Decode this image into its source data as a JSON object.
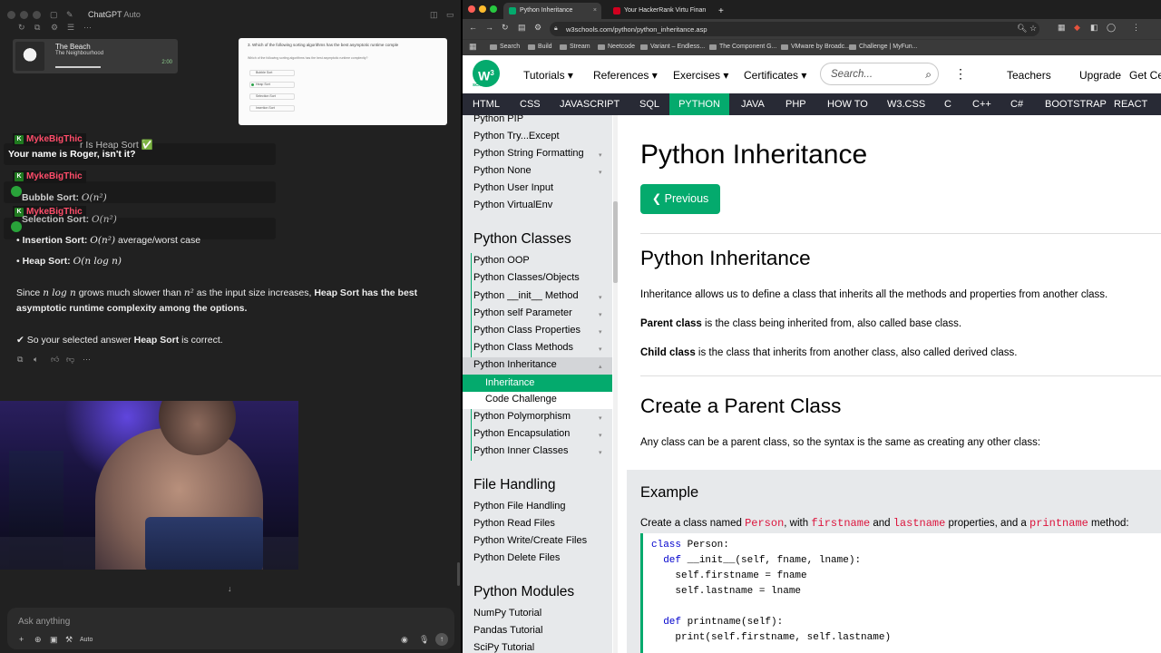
{
  "chat_window": {
    "app_title": "ChatGPT",
    "model_mode": "Auto",
    "music": {
      "song": "The Beach",
      "artist": "The Neighbourhood",
      "time": "2:00"
    },
    "quiz": {
      "question": "3. Which of the following sorting algorithms has the best asymptotic runtime comple",
      "prompt": "Which of the following sorting algorithms has the best asymptotic runtime complexity?",
      "options": [
        "Bubble Sort",
        "Heap Sort",
        "Selection Sort",
        "Insertion Sort"
      ]
    },
    "twitch": {
      "user": "MykeBigThic",
      "message": "Your name is Roger, isn't it?"
    },
    "partial_heading": "r Is Heap Sort ✅",
    "lines": {
      "bubble_label": "Bubble Sort:",
      "bubble_math": "O(n²)",
      "selection_label": "Selection Sort:",
      "selection_math": "O(n²)",
      "insertion_label": "Insertion Sort:",
      "insertion_math": "O(n²)",
      "insertion_suffix": "average/worst case",
      "heap_label": "Heap Sort:",
      "heap_math": "O(n log n)",
      "since_prefix": "Since",
      "since_math1": "n log n",
      "since_mid": "grows much slower than",
      "since_math2": "n²",
      "since_mid2": "as the input size increases,",
      "since_bold": "Heap Sort has the best",
      "since_line2": "asymptotic runtime complexity among the options.",
      "check_prefix": "✔ So your selected answer",
      "check_bold": "Heap Sort",
      "check_suffix": "is correct."
    },
    "composer": {
      "placeholder": "Ask anything",
      "mode": "Auto"
    }
  },
  "browser": {
    "tabs": [
      {
        "title": "Python Inheritance",
        "active": true
      },
      {
        "title": "Your HackerRank Virtu Finan",
        "active": false
      }
    ],
    "url": "w3schools.com/python/python_inheritance.asp",
    "bookmarks": [
      "Search",
      "Build",
      "Stream",
      "Neetcode",
      "Variant – Endless...",
      "The Component G...",
      "VMware by Broadc...",
      "Challenge | MyFun..."
    ]
  },
  "w3": {
    "logo_text": "W",
    "logo_sup": "3",
    "logo_sub": "schools",
    "nav": [
      "Tutorials ▾",
      "References ▾",
      "Exercises ▾",
      "Certificates ▾",
      "Teachers",
      "Upgrade",
      "Get Cer"
    ],
    "search_placeholder": "Search...",
    "topnav": [
      "HTML",
      "CSS",
      "JAVASCRIPT",
      "SQL",
      "PYTHON",
      "JAVA",
      "PHP",
      "HOW TO",
      "W3.CSS",
      "C",
      "C++",
      "C#",
      "BOOTSTRAP",
      "REACT"
    ],
    "sidebar": {
      "items_top": [
        "Python PIP",
        "Python Try...Except",
        "Python String Formatting",
        "Python None",
        "Python User Input",
        "Python VirtualEnv"
      ],
      "head_classes": "Python Classes",
      "items_classes": [
        "Python OOP",
        "Python Classes/Objects",
        "Python __init__ Method",
        "Python self Parameter",
        "Python Class Properties",
        "Python Class Methods",
        "Python Inheritance"
      ],
      "sub_active": "Inheritance",
      "sub_other": "Code Challenge",
      "items_after": [
        "Python Polymorphism",
        "Python Encapsulation",
        "Python Inner Classes"
      ],
      "head_files": "File Handling",
      "items_files": [
        "Python File Handling",
        "Python Read Files",
        "Python Write/Create Files",
        "Python Delete Files"
      ],
      "head_modules": "Python Modules",
      "items_modules": [
        "NumPy Tutorial",
        "Pandas Tutorial",
        "SciPy Tutorial"
      ]
    },
    "main": {
      "title": "Python Inheritance",
      "prev_button": "❮ Previous",
      "h2_inheritance": "Python Inheritance",
      "p1": "Inheritance allows us to define a class that inherits all the methods and properties from another class.",
      "p2_bold": "Parent class",
      "p2_rest": " is the class being inherited from, also called base class.",
      "p3_bold": "Child class",
      "p3_rest": " is the class that inherits from another class, also called derived class.",
      "h2_parent": "Create a Parent Class",
      "p4": "Any class can be a parent class, so the syntax is the same as creating any other class:",
      "example_title": "Example",
      "ex_p1": "Create a class named ",
      "ex_c1": "Person",
      "ex_p2": ", with ",
      "ex_c2": "firstname",
      "ex_p3": " and ",
      "ex_c3": "lastname",
      "ex_p4": " properties, and a ",
      "ex_c4": "printname",
      "ex_p5": " method:",
      "code": [
        {
          "kw": "class",
          "rest": " Person:"
        },
        {
          "kw": "  def",
          "rest": " __init__(self, fname, lname):"
        },
        {
          "kw": "",
          "rest": "    self.firstname = fname"
        },
        {
          "kw": "",
          "rest": "    self.lastname = lname"
        },
        {
          "kw": "",
          "rest": ""
        },
        {
          "kw": "  def",
          "rest": " printname(self):"
        },
        {
          "kw": "",
          "rest": "    print(self.firstname, self.lastname)"
        }
      ]
    }
  }
}
